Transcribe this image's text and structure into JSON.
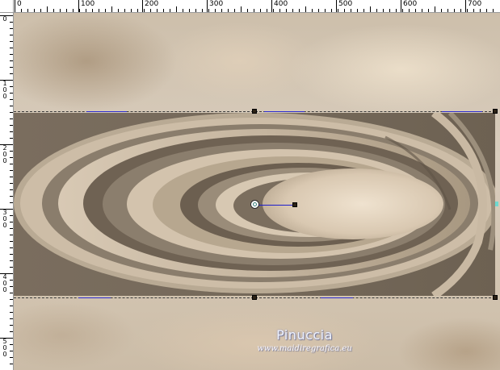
{
  "ruler": {
    "top_labels": [
      "0",
      "100",
      "200",
      "300",
      "400",
      "500",
      "600",
      "700"
    ],
    "left_labels": [
      "0",
      "1\n0\n0",
      "2\n0\n0",
      "3\n0\n0",
      "4\n0\n0",
      "5\n0\n0"
    ]
  },
  "watermark": {
    "name": "Pinuccia",
    "url": "www.maidiregrafica.eu"
  },
  "colors": {
    "selection_line": "#3a3a3a",
    "deform_handle_line": "#1e1ecc",
    "handle_fill": "#2b2115",
    "ring_dark": "#6f6253",
    "ring_light": "#e6d8c4"
  }
}
